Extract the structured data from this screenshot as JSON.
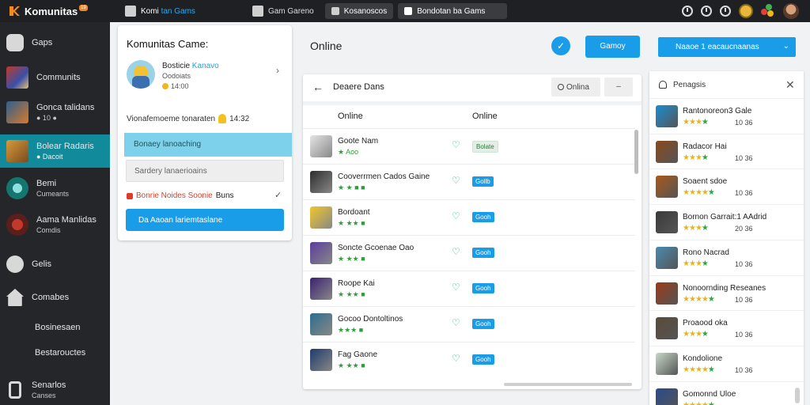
{
  "topbar": {
    "brand": "Komunitas",
    "badge": "19",
    "tabs": [
      {
        "label_a": "Komi",
        "label_b": "tan Gams",
        "state": "hl"
      },
      {
        "label_a": "Gam Gareno",
        "label_b": "",
        "state": ""
      },
      {
        "label_a": "Kosanoscos",
        "label_b": "",
        "state": ""
      },
      {
        "label_a": "Bondotan ba Gams",
        "label_b": "",
        "state": "active"
      }
    ]
  },
  "leftnav": {
    "items": [
      {
        "label": "Gaps",
        "sub": "",
        "type": "icon"
      },
      {
        "label": "Communits",
        "sub": "",
        "type": "thumb",
        "color": "#3a4fa8"
      },
      {
        "label": "Gonca talidans",
        "sub": "● 10 ●",
        "type": "thumb",
        "color": "#2e5f8e"
      },
      {
        "label": "Bolear Radaris",
        "sub": "● Dacoit",
        "type": "thumb",
        "color": "#7a4b1e"
      },
      {
        "label": "Bemi",
        "sub": "Cumeants",
        "type": "thumb",
        "color": "#14766f"
      },
      {
        "label": "Aama Manlidas",
        "sub": "Comdis",
        "type": "thumb",
        "color": "#5a1f1a"
      },
      {
        "label": "Gelis",
        "sub": "",
        "type": "icon"
      },
      {
        "label": "Comabes",
        "sub": "",
        "type": "icon"
      },
      {
        "label": "Bosinesaen",
        "sub": "",
        "type": "plain"
      },
      {
        "label": "Bestarouctes",
        "sub": "",
        "type": "plain"
      },
      {
        "label": "Senarlos",
        "sub": "Canses",
        "type": "icon"
      }
    ]
  },
  "community_panel": {
    "title": "Komunitas Came:",
    "profile_name_a": "Bosticie",
    "profile_name_b": "Kanavo",
    "profile_sub": "Oodoiats",
    "profile_sub2": "14:00",
    "chevron": "›",
    "line_text": "Vionafemoeme tonaraten",
    "line_value": "14:32",
    "band": "Bonaey lanoaching",
    "input_placeholder": "Sardery lanaerioains",
    "alert_text": "Bonrie Noides Soonie",
    "alert_tail": "Buns",
    "check": "✓",
    "button": "Da Aaoan lariemtaslane"
  },
  "center": {
    "title": "Online",
    "circle_icon": "✓",
    "top_button": "Gamoy",
    "list": {
      "back": "←",
      "title": "Deaere Dans",
      "search": "Onlina",
      "more": "–",
      "col1": "Online",
      "col2": "Online",
      "rows": [
        {
          "name": "Goote Nam",
          "meta": "★ Aoo",
          "badge": "Bolate",
          "badge_style": "light",
          "color": "#e5e5e5"
        },
        {
          "name": "Cooverrmen Cados Gaine",
          "meta": "★ ★ ■ ■",
          "badge": "Gollb",
          "badge_style": "",
          "color": "#2d2d2d"
        },
        {
          "name": "Bordoant",
          "meta": "★ ★★ ■",
          "badge": "Gooh",
          "badge_style": "",
          "color": "#f1c72a"
        },
        {
          "name": "Soncte Gcoenae Oao",
          "meta": "★ ★★ ■",
          "badge": "Gooh",
          "badge_style": "",
          "color": "#5b3d9c"
        },
        {
          "name": "Roope Kai",
          "meta": "★ ★★ ■",
          "badge": "Gooh",
          "badge_style": "",
          "color": "#3a2270"
        },
        {
          "name": "Gocoo Dontoltinos",
          "meta": "★★★ ■",
          "badge": "Gooh",
          "badge_style": "",
          "color": "#2e6c8e"
        },
        {
          "name": "Fag Gaone",
          "meta": "★ ★★ ■",
          "badge": "Gooh",
          "badge_style": "",
          "color": "#1f3a6a"
        }
      ]
    }
  },
  "right": {
    "button": "Naaoe 1 eacaucnaanas",
    "chevron": "⌄",
    "panel_title": "Penagsis",
    "close": "✕",
    "rows": [
      {
        "name": "Rantonoreon3 Gale",
        "stars": 4,
        "num": "10 36",
        "color": "#1a8ed0"
      },
      {
        "name": "Radacor Hai",
        "stars": 4,
        "num": "10 36",
        "color": "#8a4a1a"
      },
      {
        "name": "Soaent sdoe",
        "stars": 5,
        "num": "10 36",
        "color": "#a85a1a"
      },
      {
        "name": "Bornon Garrait:1 AAdrid",
        "stars": 4,
        "num": "20 36",
        "color": "#3a3a3a"
      },
      {
        "name": "Rono Nacrad",
        "stars": 4,
        "num": "10 36",
        "color": "#4a8ab0"
      },
      {
        "name": "Nonoornding Reseanes",
        "stars": 5,
        "num": "10 36",
        "color": "#9a3a1a"
      },
      {
        "name": "Proaood oka",
        "stars": 4,
        "num": "10 36",
        "color": "#5a4a3a"
      },
      {
        "name": "Kondolione",
        "stars": 5,
        "num": "10 36",
        "color": "#c8d8c8"
      },
      {
        "name": "Gomonnd Uloe",
        "stars": 5,
        "num": "",
        "color": "#2a4a8a"
      }
    ]
  }
}
